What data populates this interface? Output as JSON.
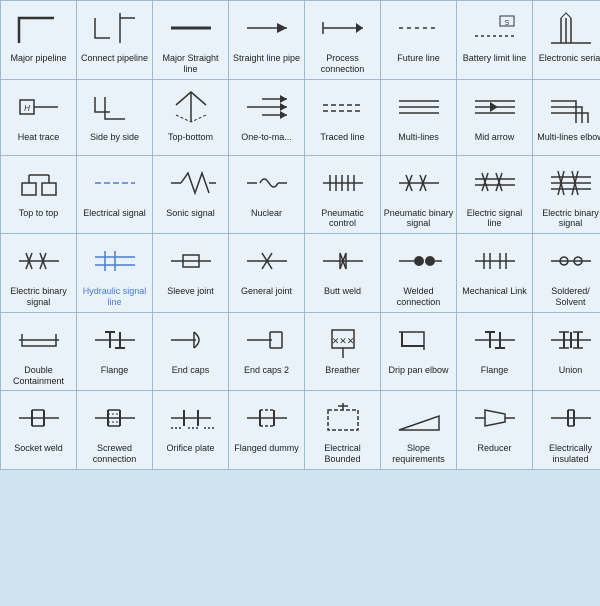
{
  "cells": [
    {
      "id": "major-pipeline",
      "label": "Major\npipeline"
    },
    {
      "id": "connect-pipeline",
      "label": "Connect\npipeline"
    },
    {
      "id": "major-straight-line",
      "label": "Major\nStraight line"
    },
    {
      "id": "straight-line-pipe",
      "label": "Straight line\npipe"
    },
    {
      "id": "process-connection",
      "label": "Process\nconnection"
    },
    {
      "id": "future-line",
      "label": "Future line"
    },
    {
      "id": "battery-limit-line",
      "label": "Battery limit\nline"
    },
    {
      "id": "electronic-serial",
      "label": "Electronic\nserial"
    },
    {
      "id": "heat-trace",
      "label": "Heat trace"
    },
    {
      "id": "side-by-side",
      "label": "Side by side"
    },
    {
      "id": "top-bottom",
      "label": "Top-bottom"
    },
    {
      "id": "one-to-many",
      "label": "One-to-ma..."
    },
    {
      "id": "traced-line",
      "label": "Traced line"
    },
    {
      "id": "multi-lines",
      "label": "Multi-lines"
    },
    {
      "id": "mid-arrow",
      "label": "Mid arrow"
    },
    {
      "id": "multi-lines-elbow",
      "label": "Multi-lines\nelbow"
    },
    {
      "id": "top-to-top",
      "label": "Top to top"
    },
    {
      "id": "electrical-signal",
      "label": "Electrical\nsignal"
    },
    {
      "id": "sonic-signal",
      "label": "Sonic signal"
    },
    {
      "id": "nuclear",
      "label": "Nuclear"
    },
    {
      "id": "pneumatic-control",
      "label": "Pneumatic\ncontrol"
    },
    {
      "id": "pneumatic-binary-signal",
      "label": "Pneumatic\nbinary signal"
    },
    {
      "id": "electric-signal-line",
      "label": "Electric\nsignal line"
    },
    {
      "id": "electric-binary-signal",
      "label": "Electric\nbinary signal"
    },
    {
      "id": "electric-binary-signal2",
      "label": "Electric\nbinary signal"
    },
    {
      "id": "hydraulic-signal-line",
      "label": "Hydraulic\nsignal line"
    },
    {
      "id": "sleeve-joint",
      "label": "Sleeve joint"
    },
    {
      "id": "general-joint",
      "label": "General joint"
    },
    {
      "id": "butt-weld",
      "label": "Butt weld"
    },
    {
      "id": "welded-connection",
      "label": "Welded\nconnection"
    },
    {
      "id": "mechanical-link",
      "label": "Mechanical\nLink"
    },
    {
      "id": "soldered-solvent",
      "label": "Soldered/\nSolvent"
    },
    {
      "id": "double-containment",
      "label": "Double\nContainment"
    },
    {
      "id": "flange",
      "label": "Flange"
    },
    {
      "id": "end-caps",
      "label": "End caps"
    },
    {
      "id": "end-caps-2",
      "label": "End caps 2"
    },
    {
      "id": "breather",
      "label": "Breather"
    },
    {
      "id": "drip-pan-elbow",
      "label": "Drip pan\nelbow"
    },
    {
      "id": "flange2",
      "label": "Flange"
    },
    {
      "id": "union",
      "label": "Union"
    },
    {
      "id": "socket-weld",
      "label": "Socket weld"
    },
    {
      "id": "screwed-connection",
      "label": "Screwed\nconnection"
    },
    {
      "id": "orifice-plate",
      "label": "Orifice plate"
    },
    {
      "id": "flanged-dummy",
      "label": "Flanged\ndummy"
    },
    {
      "id": "electrical-bounded",
      "label": "Electrical\nBounded"
    },
    {
      "id": "slope-requirements",
      "label": "Slope\nrequirements"
    },
    {
      "id": "reducer",
      "label": "Reducer"
    },
    {
      "id": "electrically-insulated",
      "label": "Electrically\ninsulated"
    }
  ]
}
